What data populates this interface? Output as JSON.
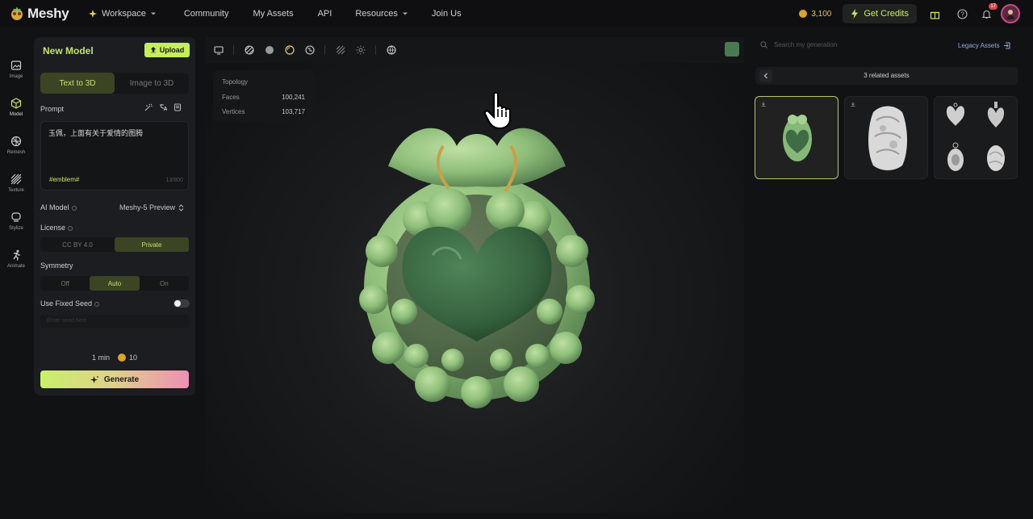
{
  "header": {
    "brand": "Meshy",
    "nav": [
      {
        "label": "Workspace",
        "icon": "sparkle-icon",
        "dropdown": true
      },
      {
        "label": "Community"
      },
      {
        "label": "My Assets"
      },
      {
        "label": "API"
      },
      {
        "label": "Resources",
        "dropdown": true
      },
      {
        "label": "Join Us"
      }
    ],
    "credits": "3,100",
    "get_credits": "Get Credits",
    "notification_count": "17"
  },
  "rail": [
    {
      "label": "Image",
      "icon": "image-icon"
    },
    {
      "label": "Model",
      "icon": "cube-icon",
      "active": true
    },
    {
      "label": "Remesh",
      "icon": "remesh-icon"
    },
    {
      "label": "Texture",
      "icon": "texture-icon"
    },
    {
      "label": "Stylize",
      "icon": "stylize-icon"
    },
    {
      "label": "Animate",
      "icon": "running-figure-icon"
    }
  ],
  "panel": {
    "title": "New Model",
    "upload": "Upload",
    "tabs": [
      "Text to 3D",
      "Image to 3D"
    ],
    "active_tab": 0,
    "prompt_label": "Prompt",
    "prompt_text": "玉佩，上面有关于爱情的图腾",
    "prompt_tag": "#emblem#",
    "prompt_counter": "13/800",
    "ai_model_label": "AI Model",
    "ai_model_value": "Meshy-5 Preview",
    "license_label": "License",
    "license_options": [
      "CC BY 4.0",
      "Private"
    ],
    "license_active": 1,
    "symmetry_label": "Symmetry",
    "symmetry_options": [
      "Off",
      "Auto",
      "On"
    ],
    "symmetry_active": 1,
    "seed_label": "Use Fixed Seed",
    "seed_enabled": false,
    "seed_placeholder": "Enter seed here",
    "time": "1 min",
    "cost": "10",
    "generate": "Generate"
  },
  "viewer": {
    "stats": {
      "topology_label": "Topology",
      "faces_label": "Faces",
      "faces": "100,241",
      "vertices_label": "Vertices",
      "vertices": "103,717"
    }
  },
  "right": {
    "search_placeholder": "Search my generation",
    "legacy": "Legacy Assets",
    "assets_title": "3 related assets"
  },
  "colors": {
    "accent": "#c6e36b",
    "jade": "#8fbf7a",
    "jade_dark": "#3f6b45"
  }
}
